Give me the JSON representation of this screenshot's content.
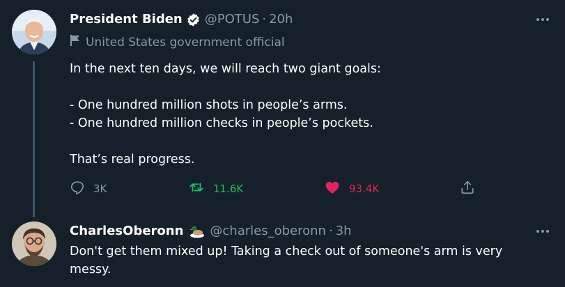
{
  "tweet": {
    "author_name": "President Biden",
    "handle": "@POTUS",
    "separator": "·",
    "time": "20h",
    "label": "United States government official",
    "text": "In the next ten days, we will reach two giant goals:\n\n- One hundred million shots in people’s arms.\n- One hundred million checks in people’s pockets.\n\nThat’s real progress.",
    "replies": "3K",
    "retweets": "11.6K",
    "likes": "93.4K"
  },
  "reply": {
    "author_name": "CharlesOberonn",
    "handle": "@charles_oberonn",
    "separator": "·",
    "time": "3h",
    "text": "Don't get them mixed up! Taking a check out of someone's arm is very\nmessy."
  },
  "colors": {
    "background": "#15202b",
    "muted": "#8899a6",
    "retweet": "#17bf63",
    "like": "#e0245e",
    "thread_line": "#3d5466"
  }
}
